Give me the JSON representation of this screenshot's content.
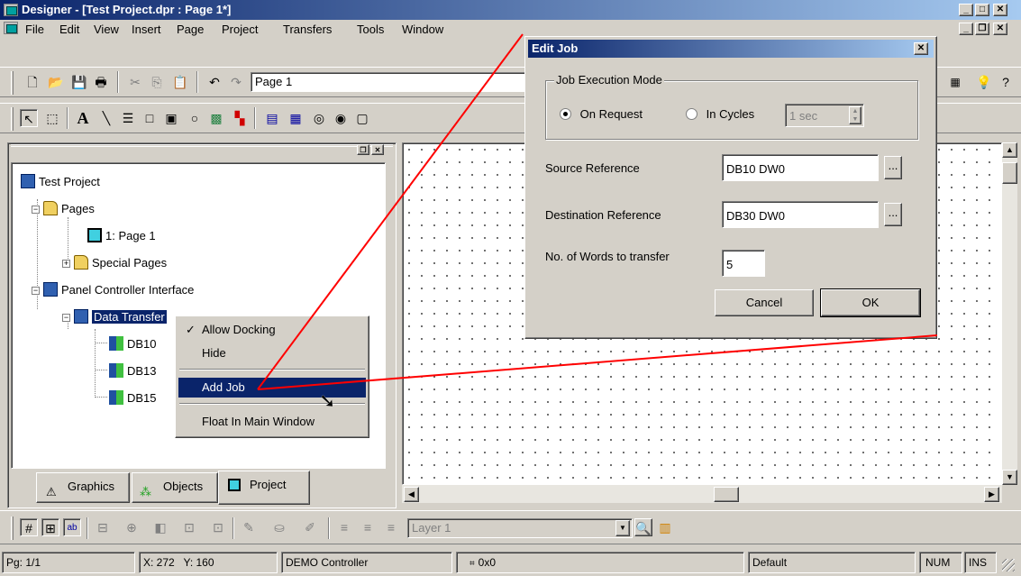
{
  "window": {
    "title": "Designer - [Test Project.dpr : Page 1*]"
  },
  "menubar": {
    "items": [
      "File",
      "Edit",
      "View",
      "Insert",
      "Page",
      "Project",
      "Transfers",
      "Tools",
      "Window"
    ]
  },
  "toolbar": {
    "page_combo_value": "Page 1"
  },
  "tree": {
    "root": "Test Project",
    "pages": "Pages",
    "page1": "1: Page 1",
    "special_pages": "Special Pages",
    "panel_controller": "Panel  Controller Interface",
    "data_transfer": "Data Transfer",
    "jobs": [
      "DB10",
      "DB13",
      "DB15"
    ]
  },
  "panel_tabs": [
    "Graphics",
    "Objects",
    "Project"
  ],
  "context_menu": {
    "items": [
      "Allow Docking",
      "Hide",
      "Add Job",
      "Float In Main Window"
    ],
    "checked": "Allow Docking",
    "selected": "Add Job"
  },
  "dialog": {
    "title": "Edit Job",
    "group_label": "Job Execution Mode",
    "mode_on_request": "On Request",
    "mode_in_cycles": "In Cycles",
    "cycle_value": "1 sec",
    "source_label": "Source Reference",
    "source_value": "DB10 DW0",
    "dest_label": "Destination Reference",
    "dest_value": "DB30 DW0",
    "words_label": "No. of Words to transfer",
    "words_value": "5",
    "cancel_label": "Cancel",
    "ok_label": "OK",
    "browse_label": "..."
  },
  "layer": {
    "value": "Layer 1"
  },
  "statusbar": {
    "page": "Pg: 1/1",
    "coords": "X: 272   Y: 160",
    "controller": "DEMO Controller",
    "size": "0x0",
    "style": "Default",
    "num": "NUM",
    "ins": "INS"
  },
  "colors": {
    "annotation_line": "#ff0000",
    "title_bar": "#0a246a",
    "selection": "#0a246a"
  }
}
